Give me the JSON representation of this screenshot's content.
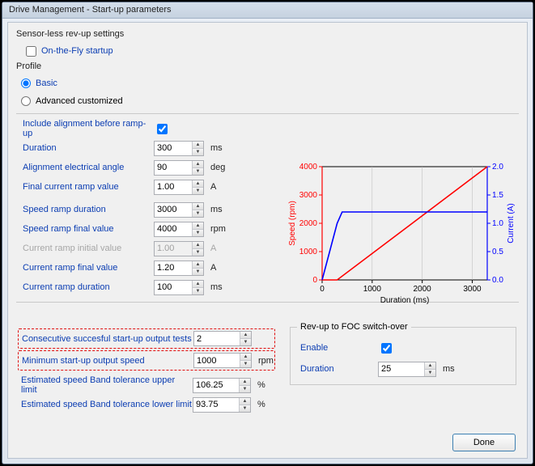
{
  "window_title": "Drive Management - Start-up parameters",
  "sensorless_title": "Sensor-less rev-up settings",
  "onthefly_label": "On-the-Fly startup",
  "onthefly_checked": false,
  "profile_title": "Profile",
  "profile_basic_label": "Basic",
  "profile_advanced_label": "Advanced customized",
  "profile_selected": "basic",
  "alignment": {
    "include_label": "Include alignment before ramp-up",
    "include_checked": true,
    "duration_label": "Duration",
    "duration_value": "300",
    "duration_unit": "ms",
    "angle_label": "Alignment electrical angle",
    "angle_value": "90",
    "angle_unit": "deg",
    "final_current_label": "Final current ramp value",
    "final_current_value": "1.00",
    "final_current_unit": "A"
  },
  "speed_ramp": {
    "duration_label": "Speed ramp duration",
    "duration_value": "3000",
    "duration_unit": "ms",
    "final_label": "Speed ramp final value",
    "final_value": "4000",
    "final_unit": "rpm"
  },
  "current_ramp": {
    "initial_label": "Current ramp initial value",
    "initial_value": "1.00",
    "initial_unit": "A",
    "final_label": "Current ramp final value",
    "final_value": "1.20",
    "final_unit": "A",
    "duration_label": "Current ramp duration",
    "duration_value": "100",
    "duration_unit": "ms"
  },
  "tests": {
    "consec_label": "Consecutive succesful start-up output tests",
    "consec_value": "2",
    "min_speed_label": "Minimum start-up output speed",
    "min_speed_value": "1000",
    "min_speed_unit": "rpm",
    "band_upper_label": "Estimated speed Band tolerance upper limit",
    "band_upper_value": "106.25",
    "band_upper_unit": "%",
    "band_lower_label": "Estimated speed Band tolerance lower limit",
    "band_lower_value": "93.75",
    "band_lower_unit": "%"
  },
  "switchover": {
    "title": "Rev-up to FOC switch-over",
    "enable_label": "Enable",
    "enable_checked": true,
    "duration_label": "Duration",
    "duration_value": "25",
    "duration_unit": "ms"
  },
  "done_label": "Done",
  "chart_data": {
    "type": "line",
    "xlabel": "Duration (ms)",
    "ylabel_left": "Speed (rpm)",
    "ylabel_right": "Current (A)",
    "x": [
      0,
      300,
      400,
      3300
    ],
    "x_ticks": [
      0,
      1000,
      2000,
      3000
    ],
    "y_left_ticks": [
      0,
      1000,
      2000,
      3000,
      4000
    ],
    "y_right_ticks": [
      0.0,
      0.5,
      1.0,
      1.5,
      2.0
    ],
    "xlim": [
      0,
      3300
    ],
    "ylim_left": [
      0,
      4000
    ],
    "ylim_right": [
      0.0,
      2.0
    ],
    "grid": true,
    "series": [
      {
        "name": "Speed",
        "axis": "left",
        "color": "red",
        "x": [
          0,
          300,
          3300
        ],
        "y": [
          0,
          0,
          4000
        ]
      },
      {
        "name": "Current",
        "axis": "right",
        "color": "blue",
        "x": [
          0,
          300,
          400,
          3300
        ],
        "y": [
          0,
          1.0,
          1.2,
          1.2
        ]
      }
    ]
  }
}
